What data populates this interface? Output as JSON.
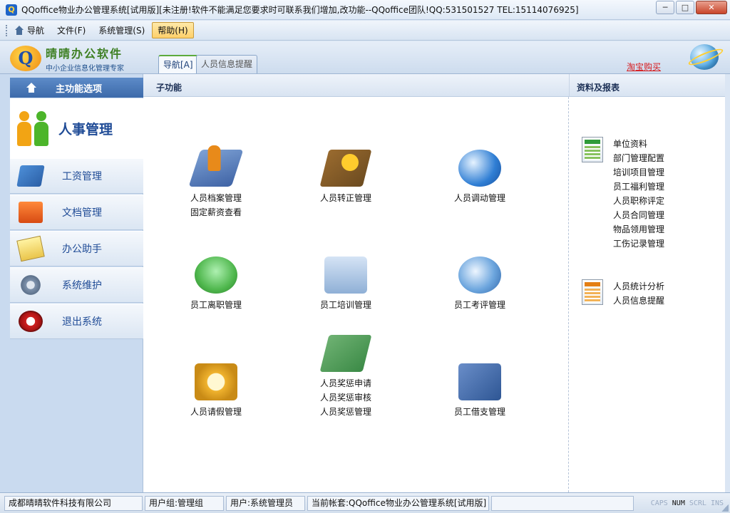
{
  "window": {
    "title": "QQoffice物业办公管理系统[试用版][未注册!软件不能满足您要求时可联系我们增加,改功能--QQoffice团队!QQ:531501527 TEL:15114076925]",
    "icon_letter": "Q",
    "buttons": {
      "minimize": "─",
      "maximize": "□",
      "close": "✕"
    }
  },
  "menu": {
    "items": [
      {
        "label": "导航",
        "icon": "home-icon"
      },
      {
        "label": "文件(F)"
      },
      {
        "label": "系统管理(S)"
      },
      {
        "label": "帮助(H)",
        "active": true
      }
    ]
  },
  "ribbon": {
    "logo_name": "晴晴办公软件",
    "logo_slogan": "中小企业信息化管理专家",
    "logo_mark": "Q",
    "tabs": [
      {
        "label": "导航[A]",
        "selected": true
      },
      {
        "label": "人员信息提醒",
        "selected": false
      }
    ],
    "taobao_link": "淘宝购买"
  },
  "sidebar": {
    "header": "主功能选项",
    "current_section": "人事管理",
    "items": [
      {
        "label": "工资管理",
        "icon": "salary-icon"
      },
      {
        "label": "文档管理",
        "icon": "document-icon"
      },
      {
        "label": "办公助手",
        "icon": "notepad-icon"
      },
      {
        "label": "系统维护",
        "icon": "gear-icon"
      },
      {
        "label": "退出系统",
        "icon": "power-icon"
      }
    ]
  },
  "main": {
    "subfunctions_header": "子功能",
    "reports_header": "资料及报表",
    "functions": [
      {
        "lines": [
          "人员档案管理",
          "固定薪资查看"
        ],
        "icon": "personnel-file-icon"
      },
      {
        "lines": [
          "人员转正管理"
        ],
        "icon": "regularization-icon"
      },
      {
        "lines": [
          "人员调动管理"
        ],
        "icon": "transfer-icon"
      },
      {
        "lines": [
          "员工离职管理"
        ],
        "icon": "resignation-icon"
      },
      {
        "lines": [
          "员工培训管理"
        ],
        "icon": "training-icon"
      },
      {
        "lines": [
          "员工考评管理"
        ],
        "icon": "evaluation-icon"
      },
      {
        "lines": [
          "人员请假管理"
        ],
        "icon": "leave-icon"
      },
      {
        "lines": [
          "人员奖惩申请",
          "人员奖惩审核",
          "人员奖惩管理"
        ],
        "icon": "reward-punish-icon"
      },
      {
        "lines": [
          "员工借支管理"
        ],
        "icon": "advance-icon"
      }
    ],
    "report_groups": [
      {
        "icon": "green-report-icon",
        "links": [
          "单位资料",
          "部门管理配置",
          "培训项目管理",
          "员工福利管理",
          "人员职称评定",
          "人员合同管理",
          "物品领用管理",
          "工伤记录管理"
        ]
      },
      {
        "icon": "orange-report-icon",
        "links": [
          "人员统计分析",
          "人员信息提醒"
        ]
      }
    ]
  },
  "statusbar": {
    "company": "成都晴晴软件科技有限公司",
    "user_group": "用户组:管理组",
    "user": "用户:系统管理员",
    "account": "当前帐套:QQoffice物业办公管理系统[试用版]",
    "keys": [
      {
        "label": "CAPS",
        "on": false
      },
      {
        "label": "NUM",
        "on": true
      },
      {
        "label": "SCRL",
        "on": false
      },
      {
        "label": "INS",
        "on": false
      }
    ]
  }
}
